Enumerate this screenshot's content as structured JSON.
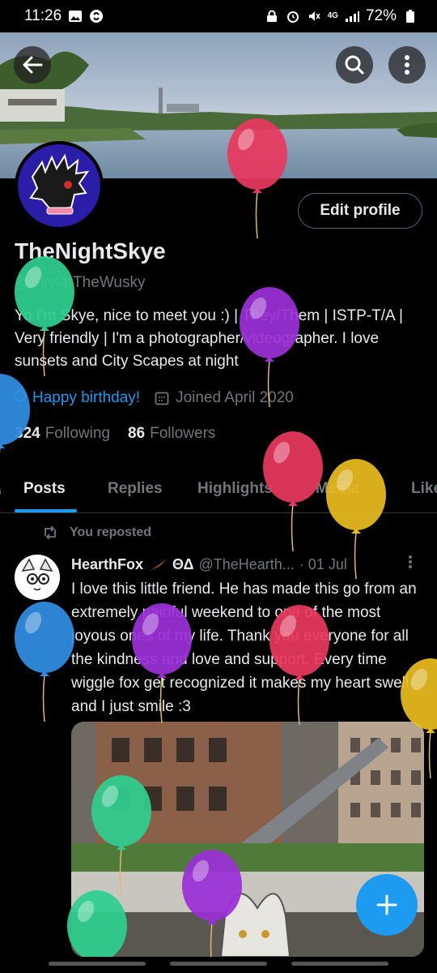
{
  "status_bar": {
    "time": "11:26",
    "network": "4G",
    "battery": "72%"
  },
  "profile": {
    "edit_label": "Edit profile",
    "name": "TheNightSkye",
    "handle": "@SkylarTheWusky",
    "bio": "Yo I'm Skye, nice to meet you :) | They/Them | ISTP-T/A | Very friendly | I'm a photographer/videographer. I love sunsets and City Scapes at night",
    "birthday": "Happy birthday!",
    "joined": "Joined April 2020",
    "following_count": "324",
    "following_label": "Following",
    "followers_count": "86",
    "followers_label": "Followers"
  },
  "tabs": [
    {
      "label": "Posts",
      "active": true
    },
    {
      "label": "Replies"
    },
    {
      "label": "Highlights"
    },
    {
      "label": "Media"
    },
    {
      "label": "Likes"
    }
  ],
  "post": {
    "repost_label": "You reposted",
    "author_name": "HearthFox",
    "author_suffix": "ΘΔ",
    "author_handle": "@TheHearth...",
    "date": "· 01 Jul",
    "text": "I love this little friend. He has made this go from an extremely painful weekend to one of the most joyous ones of my life. Thank you everyone for all the kindness and love and support. Every time wiggle fox get recognized it makes my heart swell and I just smile :3"
  },
  "fab": {
    "icon": "plus-icon"
  },
  "colors": {
    "accent": "#1d9bf0",
    "background": "#000000",
    "muted_text": "#71767b",
    "balloon_colors": [
      "#e8385f",
      "#2ecf8f",
      "#9b2fd6",
      "#e8bb1f",
      "#2f8ee3"
    ]
  },
  "icons": [
    "back-arrow-icon",
    "search-icon",
    "more-vertical-icon",
    "balloon-icon",
    "calendar-icon",
    "repost-icon",
    "plus-icon"
  ]
}
